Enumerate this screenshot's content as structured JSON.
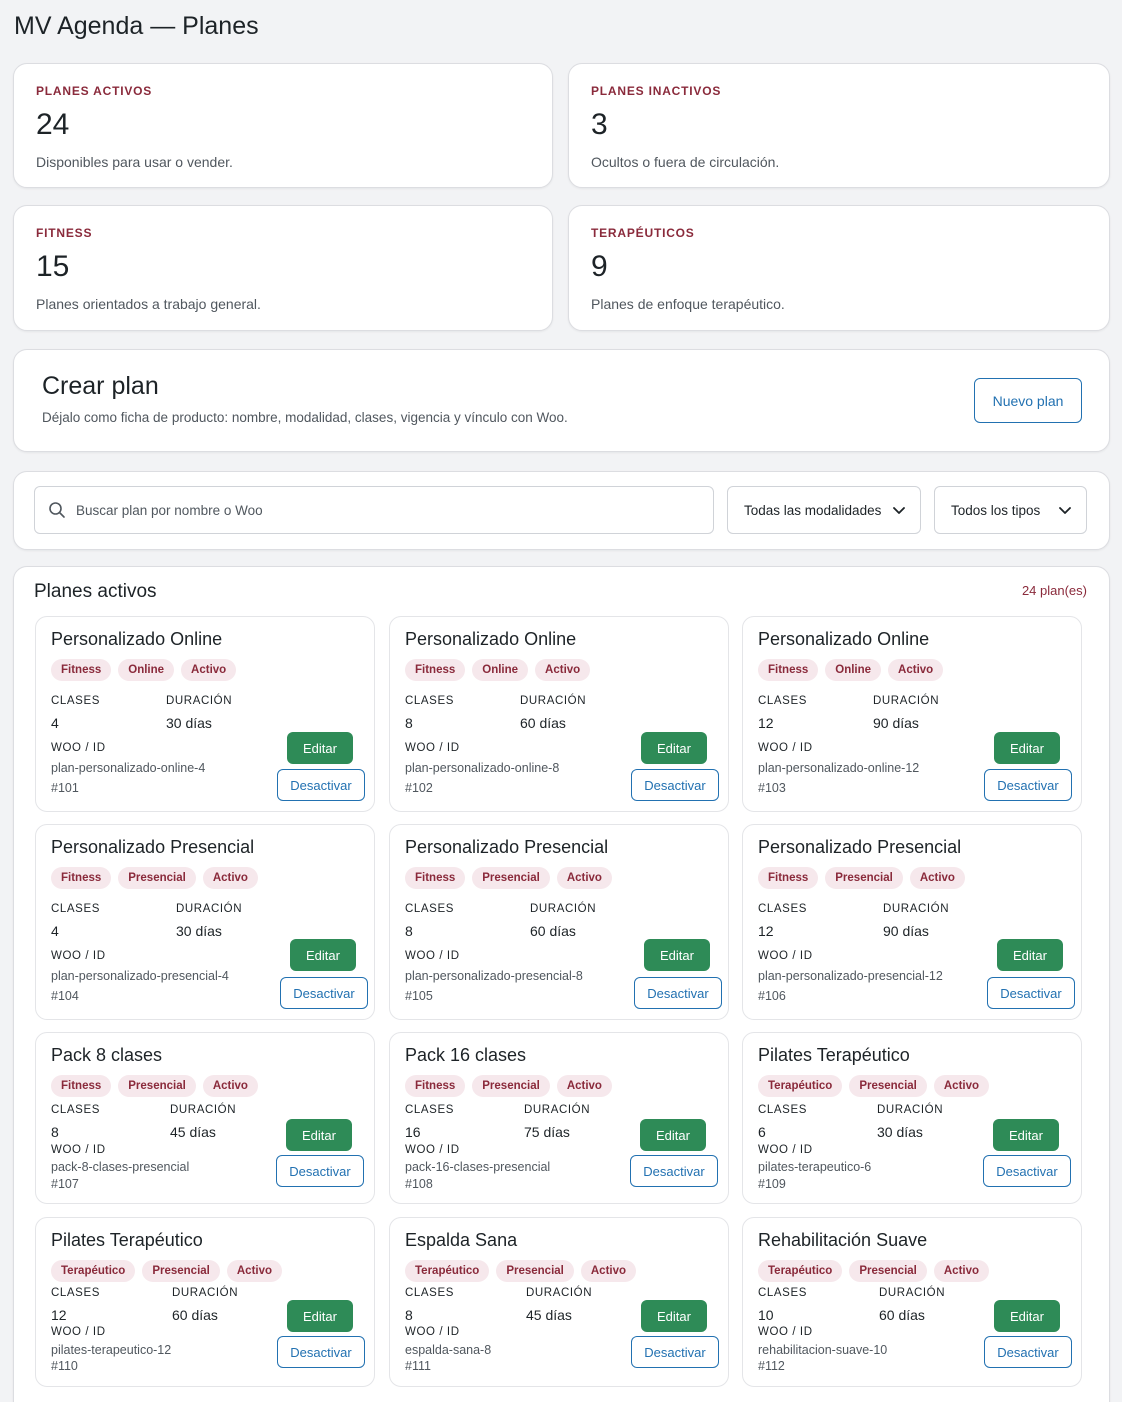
{
  "page": {
    "title": "MV Agenda — Planes"
  },
  "stats": [
    {
      "label": "PLANES ACTIVOS",
      "value": "24",
      "desc": "Disponibles para usar o vender."
    },
    {
      "label": "PLANES INACTIVOS",
      "value": "3",
      "desc": "Ocultos o fuera de circulación."
    },
    {
      "label": "FITNESS",
      "value": "15",
      "desc": "Planes orientados a trabajo general."
    },
    {
      "label": "TERAPÉUTICOS",
      "value": "9",
      "desc": "Planes de enfoque terapéutico."
    }
  ],
  "create": {
    "title": "Crear plan",
    "desc": "Déjalo como ficha de producto: nombre, modalidad, clases, vigencia y vínculo con Woo.",
    "button": "Nuevo plan"
  },
  "filters": {
    "search_placeholder": "Buscar plan por nombre o Woo",
    "modalidad": "Todas las modalidades",
    "tipo": "Todos los tipos"
  },
  "list": {
    "title": "Planes activos",
    "count": "24 plan(es)",
    "labels": {
      "clases": "CLASES",
      "duracion": "DURACIÓN",
      "woo": "WOO / ID"
    },
    "edit_label": "Editar",
    "deactivate_label": "Desactivar",
    "plans": [
      {
        "name": "Personalizado Online",
        "tags": [
          "Fitness",
          "Online",
          "Activo"
        ],
        "clases": "4",
        "duracion": "30 días",
        "slug": "plan-personalizado-online-4",
        "id": "#101"
      },
      {
        "name": "Personalizado Online",
        "tags": [
          "Fitness",
          "Online",
          "Activo"
        ],
        "clases": "8",
        "duracion": "60 días",
        "slug": "plan-personalizado-online-8",
        "id": "#102"
      },
      {
        "name": "Personalizado Online",
        "tags": [
          "Fitness",
          "Online",
          "Activo"
        ],
        "clases": "12",
        "duracion": "90 días",
        "slug": "plan-personalizado-online-12",
        "id": "#103"
      },
      {
        "name": "Personalizado Presencial",
        "tags": [
          "Fitness",
          "Presencial",
          "Activo"
        ],
        "clases": "4",
        "duracion": "30 días",
        "slug": "plan-personalizado-presencial-4",
        "id": "#104"
      },
      {
        "name": "Personalizado Presencial",
        "tags": [
          "Fitness",
          "Presencial",
          "Activo"
        ],
        "clases": "8",
        "duracion": "60 días",
        "slug": "plan-personalizado-presencial-8",
        "id": "#105"
      },
      {
        "name": "Personalizado Presencial",
        "tags": [
          "Fitness",
          "Presencial",
          "Activo"
        ],
        "clases": "12",
        "duracion": "90 días",
        "slug": "plan-personalizado-presencial-12",
        "id": "#106"
      },
      {
        "name": "Pack 8 clases",
        "tags": [
          "Fitness",
          "Presencial",
          "Activo"
        ],
        "clases": "8",
        "duracion": "45 días",
        "slug": "pack-8-clases-presencial",
        "id": "#107"
      },
      {
        "name": "Pack 16 clases",
        "tags": [
          "Fitness",
          "Presencial",
          "Activo"
        ],
        "clases": "16",
        "duracion": "75 días",
        "slug": "pack-16-clases-presencial",
        "id": "#108"
      },
      {
        "name": "Pilates Terapéutico",
        "tags": [
          "Terapéutico",
          "Presencial",
          "Activo"
        ],
        "clases": "6",
        "duracion": "30 días",
        "slug": "pilates-terapeutico-6",
        "id": "#109"
      },
      {
        "name": "Pilates Terapéutico",
        "tags": [
          "Terapéutico",
          "Presencial",
          "Activo"
        ],
        "clases": "12",
        "duracion": "60 días",
        "slug": "pilates-terapeutico-12",
        "id": "#110"
      },
      {
        "name": "Espalda Sana",
        "tags": [
          "Terapéutico",
          "Presencial",
          "Activo"
        ],
        "clases": "8",
        "duracion": "45 días",
        "slug": "espalda-sana-8",
        "id": "#111"
      },
      {
        "name": "Rehabilitación Suave",
        "tags": [
          "Terapéutico",
          "Presencial",
          "Activo"
        ],
        "clases": "10",
        "duracion": "60 días",
        "slug": "rehabilitacion-suave-10",
        "id": "#112"
      }
    ]
  }
}
